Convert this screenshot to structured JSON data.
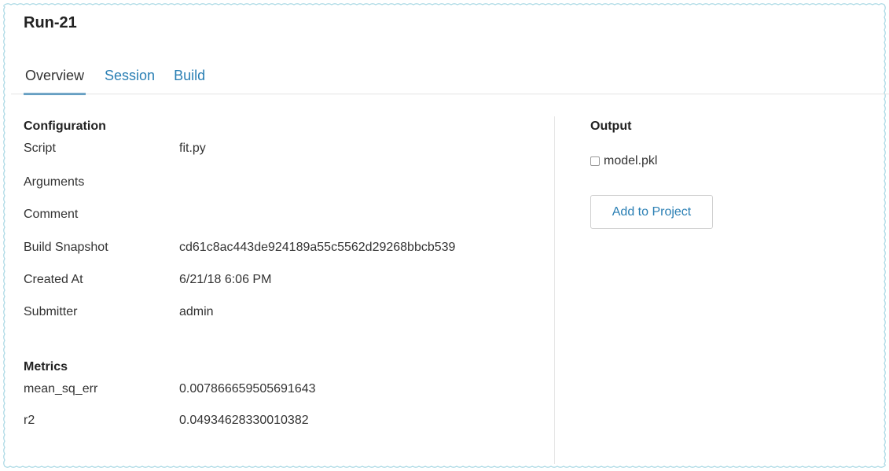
{
  "run": {
    "title": "Run-21"
  },
  "tabs": [
    {
      "label": "Overview",
      "active": true
    },
    {
      "label": "Session",
      "active": false
    },
    {
      "label": "Build",
      "active": false
    }
  ],
  "configuration": {
    "title": "Configuration",
    "rows": [
      {
        "label": "Script",
        "value": "fit.py"
      },
      {
        "label": "Arguments",
        "value": ""
      },
      {
        "label": "Comment",
        "value": ""
      },
      {
        "label": "Build Snapshot",
        "value": "cd61c8ac443de924189a55c5562d29268bbcb539"
      },
      {
        "label": "Created At",
        "value": "6/21/18 6:06 PM"
      },
      {
        "label": "Submitter",
        "value": "admin"
      }
    ]
  },
  "metrics": {
    "title": "Metrics",
    "rows": [
      {
        "label": "mean_sq_err",
        "value": "0.007866659505691643"
      },
      {
        "label": "r2",
        "value": "0.04934628330010382"
      }
    ]
  },
  "output": {
    "title": "Output",
    "files": [
      {
        "name": "model.pkl",
        "checked": false
      }
    ],
    "add_button_label": "Add to Project"
  },
  "colors": {
    "accent": "#2a7fb4",
    "text": "#333333",
    "frame_border": "#a9d8e4"
  }
}
